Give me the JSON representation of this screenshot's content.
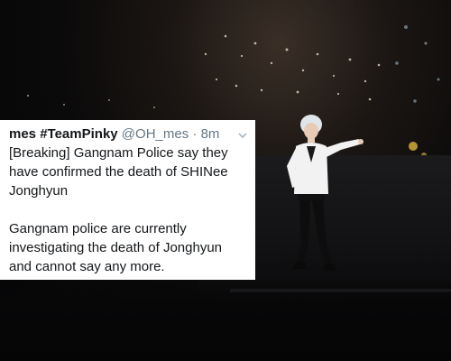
{
  "tweet": {
    "author": "mes #TeamPinky",
    "handle": "@OH_mes",
    "separator": "·",
    "time": "8m",
    "menu_icon": "chevron-down-icon",
    "paragraphs": [
      "[Breaking] Gangnam Police say they have confirmed the death of SHINee Jonghyun",
      "Gangnam police are currently investigating the death of Jonghyun and cannot say any more."
    ]
  },
  "colors": {
    "card_bg": "#ffffff",
    "text": "#14171a",
    "meta": "#657786",
    "background": "#060607",
    "suit": "#f2f2f2",
    "hair": "#dfe6ea"
  }
}
